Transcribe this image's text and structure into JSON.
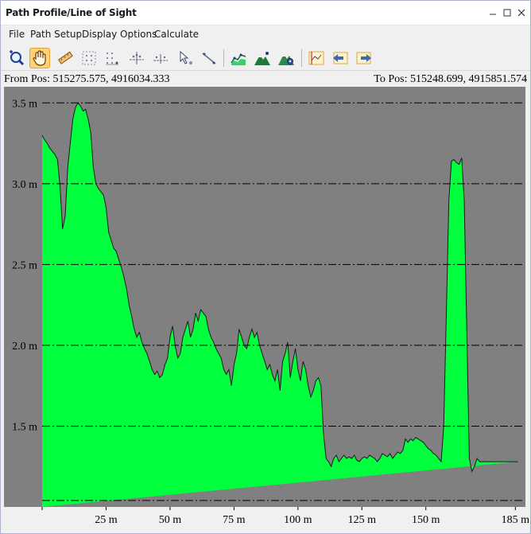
{
  "window": {
    "title": "Path Profile/Line of Sight",
    "controls": [
      "minimize",
      "maximize",
      "close"
    ]
  },
  "menu": {
    "items": [
      "File",
      "Path Setup",
      "Display Options",
      "Calculate"
    ]
  },
  "toolbar": {
    "tools": [
      {
        "icon": "zoom-icon",
        "active": false
      },
      {
        "icon": "hand-pan-icon",
        "active": true
      },
      {
        "icon": "ruler-icon",
        "active": false
      },
      {
        "icon": "grid-select-icon",
        "active": false
      },
      {
        "icon": "dot-grid-icon",
        "active": false
      },
      {
        "icon": "axis-points-icon",
        "active": false
      },
      {
        "icon": "axis-line-icon",
        "active": false
      },
      {
        "icon": "pointer-point-icon",
        "active": false
      },
      {
        "icon": "pointer-line-icon",
        "active": false
      },
      {
        "icon": "profile-chart-icon",
        "active": false
      },
      {
        "icon": "terrain-icon",
        "active": false
      },
      {
        "icon": "terrain-settings-icon",
        "active": false
      },
      {
        "icon": "signal-chart-icon",
        "active": false
      },
      {
        "icon": "arrow-left-chart-icon",
        "active": false
      },
      {
        "icon": "arrow-right-chart-icon",
        "active": false
      }
    ]
  },
  "positions": {
    "from_label": "From Pos: 515275.575, 4916034.333",
    "to_label": "To Pos: 515248.699, 4915851.574"
  },
  "colors": {
    "plot_background": "#808080",
    "terrain_fill": "#00ff3c",
    "terrain_stroke": "#1a1a1a",
    "gridline": "#000000"
  },
  "chart_data": {
    "type": "area",
    "xlabel": "",
    "ylabel": "",
    "x_unit": "m",
    "y_unit": "m",
    "xlim": [
      0,
      188
    ],
    "ylim": [
      1.0,
      3.6
    ],
    "y_ticks": [
      {
        "value": 1.5,
        "label": "1.5 m"
      },
      {
        "value": 2.0,
        "label": "2.0 m"
      },
      {
        "value": 2.5,
        "label": "2.5 m"
      },
      {
        "value": 3.0,
        "label": "3.0 m"
      },
      {
        "value": 3.5,
        "label": "3.5 m"
      }
    ],
    "x_ticks": [
      {
        "value": 25,
        "label": "25 m"
      },
      {
        "value": 50,
        "label": "50 m"
      },
      {
        "value": 75,
        "label": "75 m"
      },
      {
        "value": 100,
        "label": "100 m"
      },
      {
        "value": 125,
        "label": "125 m"
      },
      {
        "value": 150,
        "label": "150 m"
      },
      {
        "value": 185,
        "label": "185 m"
      }
    ],
    "grid": "horizontal dash-dot",
    "legend": "none",
    "x": [
      0,
      1,
      2,
      3,
      4,
      5,
      6,
      7,
      8,
      9,
      10,
      11,
      12,
      13,
      14,
      15,
      16,
      17,
      18,
      19,
      20,
      21,
      22,
      23,
      24,
      25,
      26,
      27,
      28,
      29,
      30,
      31,
      32,
      33,
      34,
      35,
      36,
      37,
      38,
      39,
      40,
      41,
      42,
      43,
      44,
      45,
      46,
      47,
      48,
      49,
      50,
      51,
      52,
      53,
      54,
      55,
      56,
      57,
      58,
      59,
      60,
      61,
      62,
      63,
      64,
      65,
      66,
      67,
      68,
      69,
      70,
      71,
      72,
      73,
      74,
      75,
      76,
      77,
      78,
      79,
      80,
      81,
      82,
      83,
      84,
      85,
      86,
      87,
      88,
      89,
      90,
      91,
      92,
      93,
      94,
      95,
      96,
      97,
      98,
      99,
      100,
      101,
      102,
      103,
      104,
      105,
      106,
      107,
      108,
      109,
      110,
      111,
      112,
      113,
      114,
      115,
      116,
      117,
      118,
      119,
      120,
      121,
      122,
      123,
      124,
      125,
      126,
      127,
      128,
      129,
      130,
      131,
      132,
      133,
      134,
      135,
      136,
      137,
      138,
      139,
      140,
      141,
      142,
      143,
      144,
      145,
      146,
      147,
      148,
      149,
      150,
      151,
      152,
      153,
      154,
      155,
      156,
      157,
      158,
      159,
      160,
      161,
      162,
      163,
      164,
      165,
      166,
      167,
      168,
      169,
      170,
      171,
      172,
      173,
      174,
      175,
      176,
      177,
      178,
      179,
      180,
      181,
      182,
      183,
      184,
      185,
      186,
      187,
      188
    ],
    "y": [
      3.3,
      3.27,
      3.25,
      3.22,
      3.2,
      3.18,
      3.15,
      2.98,
      2.72,
      2.8,
      3.1,
      3.25,
      3.4,
      3.47,
      3.5,
      3.48,
      3.45,
      3.46,
      3.4,
      3.32,
      3.1,
      3.0,
      2.97,
      2.95,
      2.93,
      2.85,
      2.7,
      2.65,
      2.6,
      2.58,
      2.53,
      2.48,
      2.42,
      2.35,
      2.25,
      2.18,
      2.1,
      2.05,
      2.08,
      2.02,
      1.98,
      1.95,
      1.9,
      1.85,
      1.82,
      1.84,
      1.8,
      1.82,
      1.88,
      1.92,
      2.05,
      2.12,
      2.0,
      1.92,
      1.95,
      2.05,
      2.1,
      2.15,
      2.05,
      2.1,
      2.2,
      2.15,
      2.22,
      2.2,
      2.18,
      2.1,
      2.05,
      2.02,
      1.98,
      1.95,
      1.92,
      1.85,
      1.82,
      1.85,
      1.75,
      1.88,
      1.95,
      2.1,
      2.05,
      2.0,
      1.98,
      2.05,
      2.1,
      2.05,
      2.08,
      2.0,
      1.95,
      1.9,
      1.85,
      1.88,
      1.82,
      1.78,
      1.85,
      1.72,
      1.9,
      1.95,
      2.02,
      1.8,
      1.9,
      1.98,
      1.85,
      1.78,
      1.9,
      1.85,
      1.75,
      1.68,
      1.72,
      1.78,
      1.8,
      1.75,
      1.45,
      1.3,
      1.28,
      1.25,
      1.3,
      1.32,
      1.28,
      1.3,
      1.32,
      1.3,
      1.31,
      1.3,
      1.32,
      1.29,
      1.28,
      1.3,
      1.31,
      1.3,
      1.32,
      1.31,
      1.3,
      1.28,
      1.3,
      1.33,
      1.32,
      1.31,
      1.33,
      1.3,
      1.32,
      1.34,
      1.33,
      1.35,
      1.42,
      1.4,
      1.42,
      1.41,
      1.43,
      1.42,
      1.41,
      1.4,
      1.38,
      1.36,
      1.35,
      1.33,
      1.32,
      1.3,
      1.28,
      1.5,
      2.2,
      2.9,
      3.14,
      3.15,
      3.13,
      3.12,
      3.16,
      2.9,
      2.1,
      1.3,
      1.22,
      1.25,
      1.3,
      1.28,
      1.28,
      1.28,
      1.28,
      1.28,
      1.28,
      1.28,
      1.28,
      1.28,
      1.28,
      1.28,
      1.28,
      1.28,
      1.28,
      1.28,
      1.28
    ]
  }
}
